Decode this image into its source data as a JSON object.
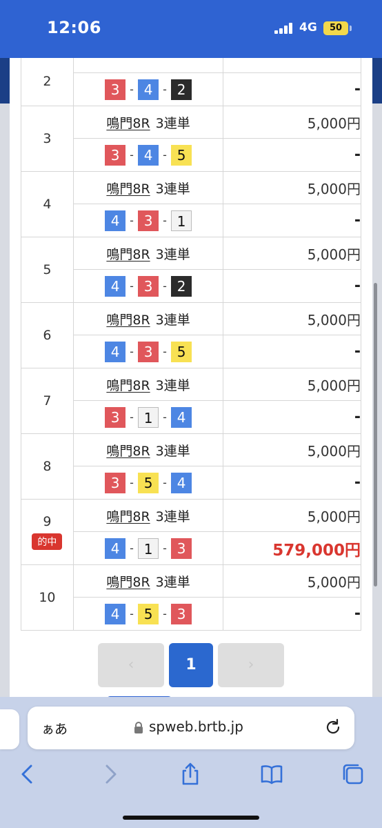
{
  "status_bar": {
    "time": "12:06",
    "network": "4G",
    "battery": "50"
  },
  "rows": [
    {
      "no": "2",
      "race": "",
      "type": "",
      "combo": [
        3,
        4,
        2
      ],
      "amount": "",
      "payout": "-",
      "hit": false,
      "partial": true
    },
    {
      "no": "3",
      "race": "鳴門8R",
      "type": "3連単",
      "combo": [
        3,
        4,
        5
      ],
      "amount": "5,000円",
      "payout": "-",
      "hit": false
    },
    {
      "no": "4",
      "race": "鳴門8R",
      "type": "3連単",
      "combo": [
        4,
        3,
        1
      ],
      "amount": "5,000円",
      "payout": "-",
      "hit": false
    },
    {
      "no": "5",
      "race": "鳴門8R",
      "type": "3連単",
      "combo": [
        4,
        3,
        2
      ],
      "amount": "5,000円",
      "payout": "-",
      "hit": false
    },
    {
      "no": "6",
      "race": "鳴門8R",
      "type": "3連単",
      "combo": [
        4,
        3,
        5
      ],
      "amount": "5,000円",
      "payout": "-",
      "hit": false
    },
    {
      "no": "7",
      "race": "鳴門8R",
      "type": "3連単",
      "combo": [
        3,
        1,
        4
      ],
      "amount": "5,000円",
      "payout": "-",
      "hit": false
    },
    {
      "no": "8",
      "race": "鳴門8R",
      "type": "3連単",
      "combo": [
        3,
        5,
        4
      ],
      "amount": "5,000円",
      "payout": "-",
      "hit": false
    },
    {
      "no": "9",
      "race": "鳴門8R",
      "type": "3連単",
      "combo": [
        4,
        1,
        3
      ],
      "amount": "5,000円",
      "payout": "579,000円",
      "hit": true,
      "hit_label": "的中"
    },
    {
      "no": "10",
      "race": "鳴門8R",
      "type": "3連単",
      "combo": [
        4,
        5,
        3
      ],
      "amount": "5,000円",
      "payout": "-",
      "hit": false
    }
  ],
  "combo_separator": "-",
  "pagination": {
    "prev": "‹",
    "current": "1",
    "next": "›"
  },
  "browser": {
    "text_size_label": "ぁあ",
    "url": "spweb.brtb.jp"
  },
  "colors": {
    "boat1": "#f3f3f3",
    "boat2": "#2b2b2b",
    "boat3": "#e0575b",
    "boat4": "#4d86e3",
    "boat5": "#f8e153",
    "hit": "#d9362f",
    "accent": "#2b68cf"
  }
}
